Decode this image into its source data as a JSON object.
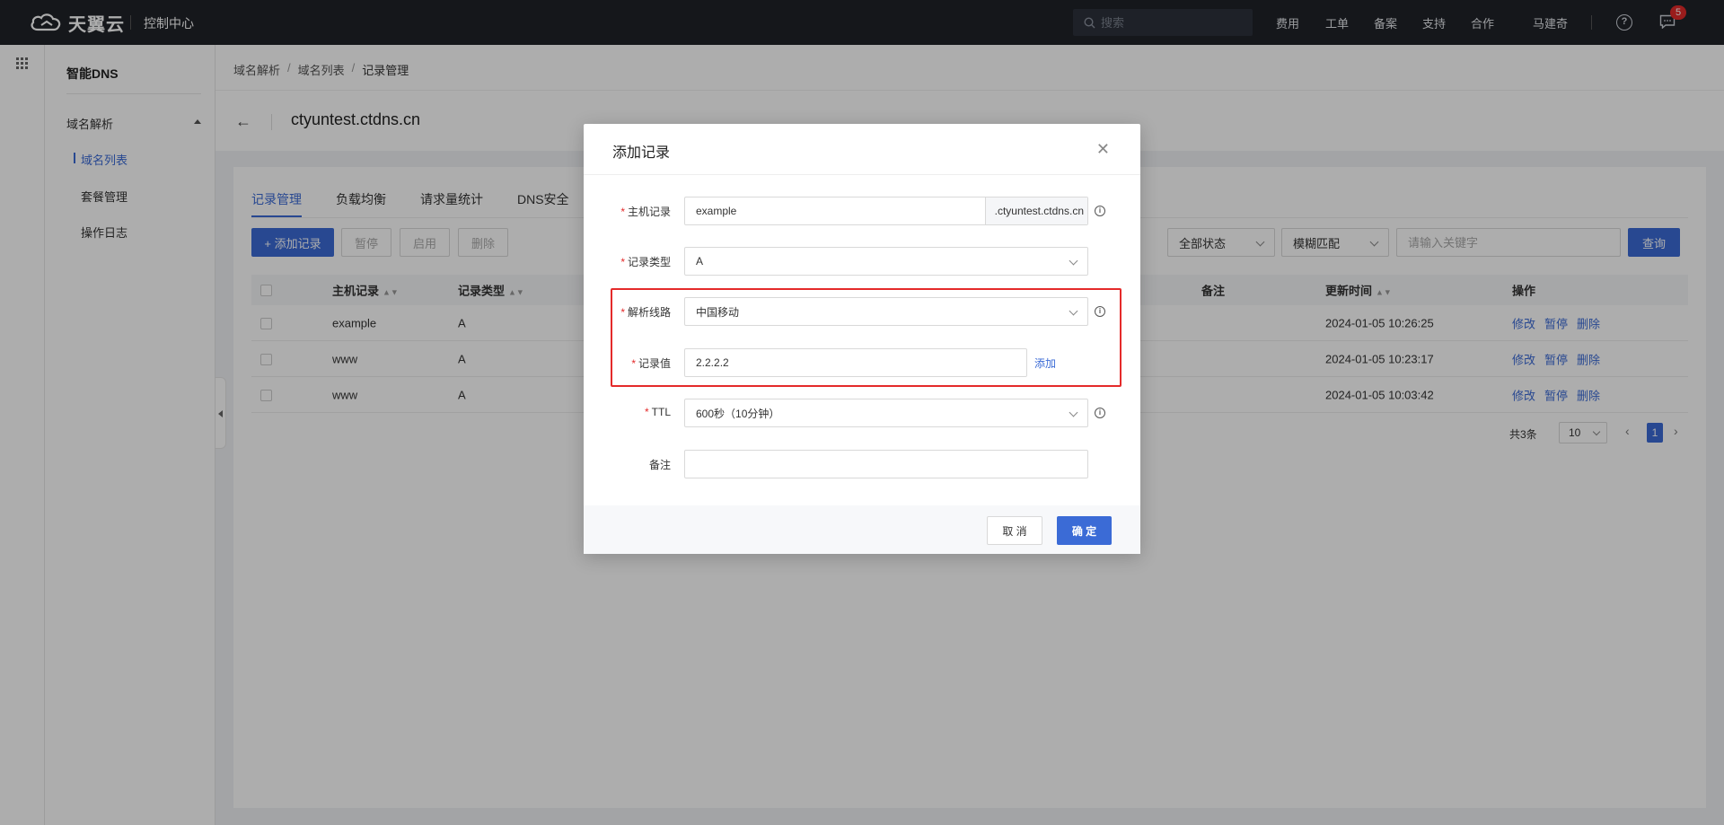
{
  "topbar": {
    "brand": "天翼云",
    "console": "控制中心",
    "search_placeholder": "搜索",
    "nav": [
      "费用",
      "工单",
      "备案",
      "支持",
      "合作"
    ],
    "user": "马建奇",
    "message_count": "5",
    "icons": [
      "cloud-logo-icon",
      "search-icon",
      "help-icon",
      "message-icon"
    ]
  },
  "sidebar": {
    "title": "智能DNS",
    "group": "域名解析",
    "items": [
      "域名列表",
      "套餐管理",
      "操作日志"
    ]
  },
  "breadcrumb": [
    "域名解析",
    "域名列表",
    "记录管理"
  ],
  "page": {
    "domain": "ctyuntest.ctdns.cn"
  },
  "tabs": [
    "记录管理",
    "负载均衡",
    "请求量统计",
    "DNS安全"
  ],
  "toolbar": {
    "add": "+ 添加记录",
    "pause": "暂停",
    "enable": "启用",
    "delete": "删除",
    "status_filter": "全部状态",
    "match_filter": "模糊匹配",
    "keyword_placeholder": "请输入关键字",
    "query": "查询"
  },
  "table": {
    "headers": {
      "host": "主机记录",
      "type": "记录类型",
      "remark": "备注",
      "updated": "更新时间",
      "ops": "操作"
    },
    "rows": [
      {
        "host": "example",
        "type": "A",
        "updated": "2024-01-05 10:26:25"
      },
      {
        "host": "www",
        "type": "A",
        "updated": "2024-01-05 10:23:17"
      },
      {
        "host": "www",
        "type": "A",
        "updated": "2024-01-05 10:03:42"
      }
    ],
    "ops": {
      "edit": "修改",
      "pause": "暂停",
      "delete": "删除"
    }
  },
  "pager": {
    "total": "共3条",
    "page_size": "10",
    "current": "1"
  },
  "modal": {
    "title": "添加记录",
    "host_label": "主机记录",
    "host_value": "example",
    "host_suffix": ".ctyuntest.ctdns.cn",
    "type_label": "记录类型",
    "type_value": "A",
    "line_label": "解析线路",
    "line_value": "中国移动",
    "value_label": "记录值",
    "value_value": "2.2.2.2",
    "add_link": "添加",
    "ttl_label": "TTL",
    "ttl_value": "600秒（10分钟）",
    "remark_label": "备注",
    "remark_value": "",
    "cancel": "取 消",
    "ok": "确 定"
  },
  "colors": {
    "primary": "#3b6bd6",
    "highlight": "#e42a2a",
    "topbar": "#1f2229"
  }
}
